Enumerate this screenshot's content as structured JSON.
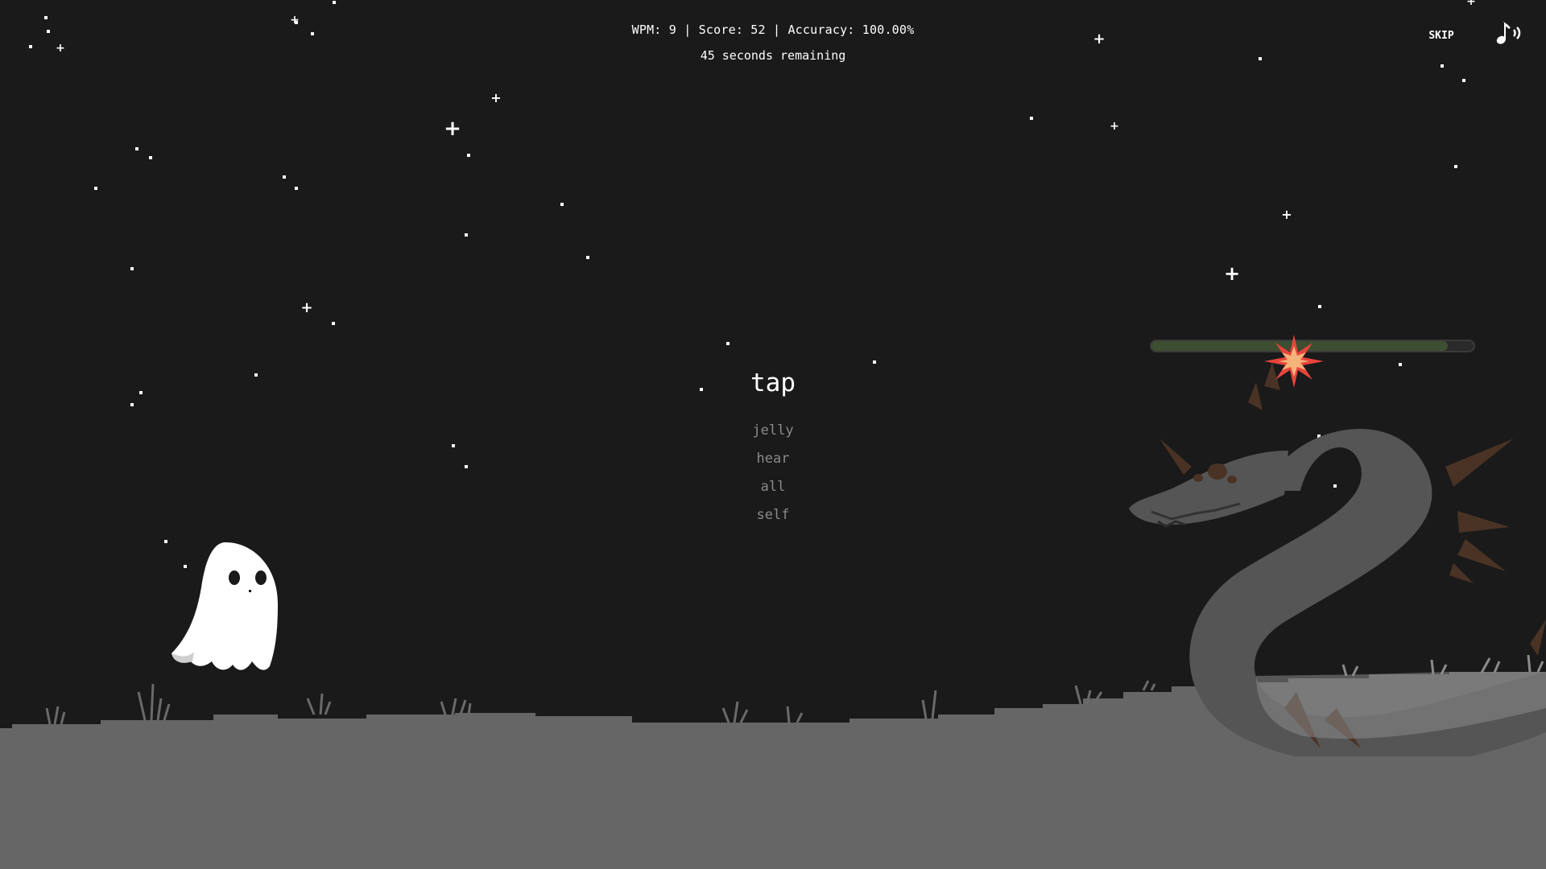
{
  "hud": {
    "stats_text": "WPM: 9 | Score: 52 | Accuracy: 100.00%",
    "timer_text": "45 seconds remaining"
  },
  "controls": {
    "skip_label": "SKIP",
    "sound_icon": "music-sound-icon"
  },
  "words": {
    "current": "tap",
    "queue": [
      "jelly",
      "hear",
      "all",
      "self"
    ]
  },
  "enemy": {
    "health_fraction": 0.92
  },
  "colors": {
    "background": "#1a1a1a",
    "ground": "#666666",
    "ghost": "#ffffff",
    "dragon": "#555555",
    "health_fill": "#3d4f30",
    "hit_burst": "#e8453c",
    "upcoming_word": "#8a8a8a"
  }
}
